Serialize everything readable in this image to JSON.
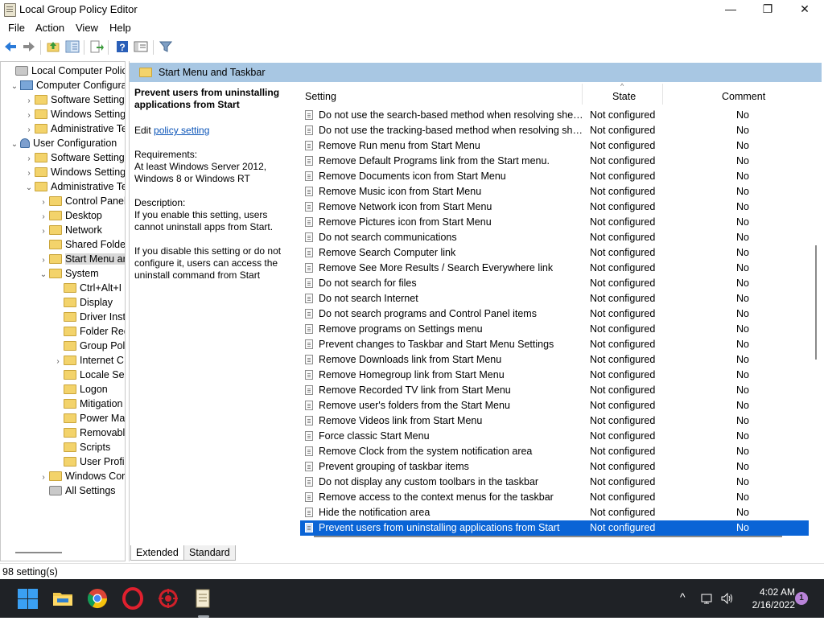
{
  "window": {
    "title": "Local Group Policy Editor",
    "min_glyph": "—",
    "max_glyph": "❐",
    "close_glyph": "✕"
  },
  "menu": [
    "File",
    "Action",
    "View",
    "Help"
  ],
  "toolbar_icons": [
    "back-icon",
    "forward-icon",
    "up-folder-icon",
    "show-hide-tree-icon",
    "export-list-icon",
    "help-icon",
    "properties-icon",
    "filter-icon"
  ],
  "tree": [
    {
      "label": "Local Computer Policy",
      "indent": 0,
      "arrow": "",
      "icon": "gear"
    },
    {
      "label": "Computer Configura",
      "indent": 1,
      "arrow": "⌄",
      "icon": "pc"
    },
    {
      "label": "Software Settings",
      "indent": 2,
      "arrow": "›",
      "icon": "folder"
    },
    {
      "label": "Windows Setting",
      "indent": 2,
      "arrow": "›",
      "icon": "folder"
    },
    {
      "label": "Administrative Te",
      "indent": 2,
      "arrow": "›",
      "icon": "folder"
    },
    {
      "label": "User Configuration",
      "indent": 1,
      "arrow": "⌄",
      "icon": "user"
    },
    {
      "label": "Software Settings",
      "indent": 2,
      "arrow": "›",
      "icon": "folder"
    },
    {
      "label": "Windows Setting",
      "indent": 2,
      "arrow": "›",
      "icon": "folder"
    },
    {
      "label": "Administrative Te",
      "indent": 2,
      "arrow": "⌄",
      "icon": "folder"
    },
    {
      "label": "Control Panel",
      "indent": 3,
      "arrow": "›",
      "icon": "folder"
    },
    {
      "label": "Desktop",
      "indent": 3,
      "arrow": "›",
      "icon": "folder"
    },
    {
      "label": "Network",
      "indent": 3,
      "arrow": "›",
      "icon": "folder"
    },
    {
      "label": "Shared Folder",
      "indent": 3,
      "arrow": "",
      "icon": "folder"
    },
    {
      "label": "Start Menu ar",
      "indent": 3,
      "arrow": "›",
      "icon": "folder",
      "selected": true
    },
    {
      "label": "System",
      "indent": 3,
      "arrow": "⌄",
      "icon": "folder"
    },
    {
      "label": "Ctrl+Alt+I",
      "indent": 4,
      "arrow": "",
      "icon": "folder"
    },
    {
      "label": "Display",
      "indent": 4,
      "arrow": "",
      "icon": "folder"
    },
    {
      "label": "Driver Inst",
      "indent": 4,
      "arrow": "",
      "icon": "folder"
    },
    {
      "label": "Folder Red",
      "indent": 4,
      "arrow": "",
      "icon": "folder"
    },
    {
      "label": "Group Pol",
      "indent": 4,
      "arrow": "",
      "icon": "folder"
    },
    {
      "label": "Internet C",
      "indent": 4,
      "arrow": "›",
      "icon": "folder"
    },
    {
      "label": "Locale Ser",
      "indent": 4,
      "arrow": "",
      "icon": "folder"
    },
    {
      "label": "Logon",
      "indent": 4,
      "arrow": "",
      "icon": "folder"
    },
    {
      "label": "Mitigation",
      "indent": 4,
      "arrow": "",
      "icon": "folder"
    },
    {
      "label": "Power Ma",
      "indent": 4,
      "arrow": "",
      "icon": "folder"
    },
    {
      "label": "Removabl",
      "indent": 4,
      "arrow": "",
      "icon": "folder"
    },
    {
      "label": "Scripts",
      "indent": 4,
      "arrow": "",
      "icon": "folder"
    },
    {
      "label": "User Profi",
      "indent": 4,
      "arrow": "",
      "icon": "folder"
    },
    {
      "label": "Windows Cor",
      "indent": 3,
      "arrow": "›",
      "icon": "folder"
    },
    {
      "label": "All Settings",
      "indent": 3,
      "arrow": "",
      "icon": "gear"
    }
  ],
  "panel": {
    "header": "Start Menu and Taskbar",
    "desc_title": "Prevent users from uninstalling applications from Start",
    "edit_prefix": "Edit ",
    "edit_link": "policy setting ",
    "requirements_label": "Requirements:",
    "requirements": "At least Windows Server 2012, Windows 8 or Windows RT",
    "description_label": "Description:",
    "description_1": "If you enable this setting, users cannot uninstall apps from Start.",
    "description_2": "If you disable this setting or do not configure it, users can access the uninstall command from Start"
  },
  "columns": {
    "setting": "Setting",
    "state": "State",
    "comment": "Comment",
    "sort_glyph": "^"
  },
  "rows": [
    {
      "setting": "Do not use the search-based method when resolving shell s...",
      "state": "Not configured",
      "comment": "No"
    },
    {
      "setting": "Do not use the tracking-based method when resolving shell ...",
      "state": "Not configured",
      "comment": "No"
    },
    {
      "setting": "Remove Run menu from Start Menu",
      "state": "Not configured",
      "comment": "No"
    },
    {
      "setting": "Remove Default Programs link from the Start menu.",
      "state": "Not configured",
      "comment": "No"
    },
    {
      "setting": "Remove Documents icon from Start Menu",
      "state": "Not configured",
      "comment": "No"
    },
    {
      "setting": "Remove Music icon from Start Menu",
      "state": "Not configured",
      "comment": "No"
    },
    {
      "setting": "Remove Network icon from Start Menu",
      "state": "Not configured",
      "comment": "No"
    },
    {
      "setting": "Remove Pictures icon from Start Menu",
      "state": "Not configured",
      "comment": "No"
    },
    {
      "setting": "Do not search communications",
      "state": "Not configured",
      "comment": "No"
    },
    {
      "setting": "Remove Search Computer link",
      "state": "Not configured",
      "comment": "No"
    },
    {
      "setting": "Remove See More Results / Search Everywhere link",
      "state": "Not configured",
      "comment": "No"
    },
    {
      "setting": "Do not search for files",
      "state": "Not configured",
      "comment": "No"
    },
    {
      "setting": "Do not search Internet",
      "state": "Not configured",
      "comment": "No"
    },
    {
      "setting": "Do not search programs and Control Panel items",
      "state": "Not configured",
      "comment": "No"
    },
    {
      "setting": "Remove programs on Settings menu",
      "state": "Not configured",
      "comment": "No"
    },
    {
      "setting": "Prevent changes to Taskbar and Start Menu Settings",
      "state": "Not configured",
      "comment": "No"
    },
    {
      "setting": "Remove Downloads link from Start Menu",
      "state": "Not configured",
      "comment": "No"
    },
    {
      "setting": "Remove Homegroup link from Start Menu",
      "state": "Not configured",
      "comment": "No"
    },
    {
      "setting": "Remove Recorded TV link from Start Menu",
      "state": "Not configured",
      "comment": "No"
    },
    {
      "setting": "Remove user's folders from the Start Menu",
      "state": "Not configured",
      "comment": "No"
    },
    {
      "setting": "Remove Videos link from Start Menu",
      "state": "Not configured",
      "comment": "No"
    },
    {
      "setting": "Force classic Start Menu",
      "state": "Not configured",
      "comment": "No"
    },
    {
      "setting": "Remove Clock from the system notification area",
      "state": "Not configured",
      "comment": "No"
    },
    {
      "setting": "Prevent grouping of taskbar items",
      "state": "Not configured",
      "comment": "No"
    },
    {
      "setting": "Do not display any custom toolbars in the taskbar",
      "state": "Not configured",
      "comment": "No"
    },
    {
      "setting": "Remove access to the context menus for the taskbar",
      "state": "Not configured",
      "comment": "No"
    },
    {
      "setting": "Hide the notification area",
      "state": "Not configured",
      "comment": "No"
    },
    {
      "setting": "Prevent users from uninstalling applications from Start",
      "state": "Not configured",
      "comment": "No",
      "selected": true
    }
  ],
  "tabs": [
    "Extended",
    "Standard"
  ],
  "status": "98 setting(s)",
  "taskbar": {
    "apps": [
      "windows-start-icon",
      "file-explorer-icon",
      "chrome-icon",
      "opera-icon",
      "red-app-icon",
      "notepad-icon"
    ],
    "tray_chevron": "^",
    "time": "4:02 AM",
    "date": "2/16/2022",
    "notification_count": "1"
  },
  "colors": {
    "selection": "#0a64d6",
    "header_band": "#a8c7e3",
    "taskbar": "#1f2226"
  }
}
